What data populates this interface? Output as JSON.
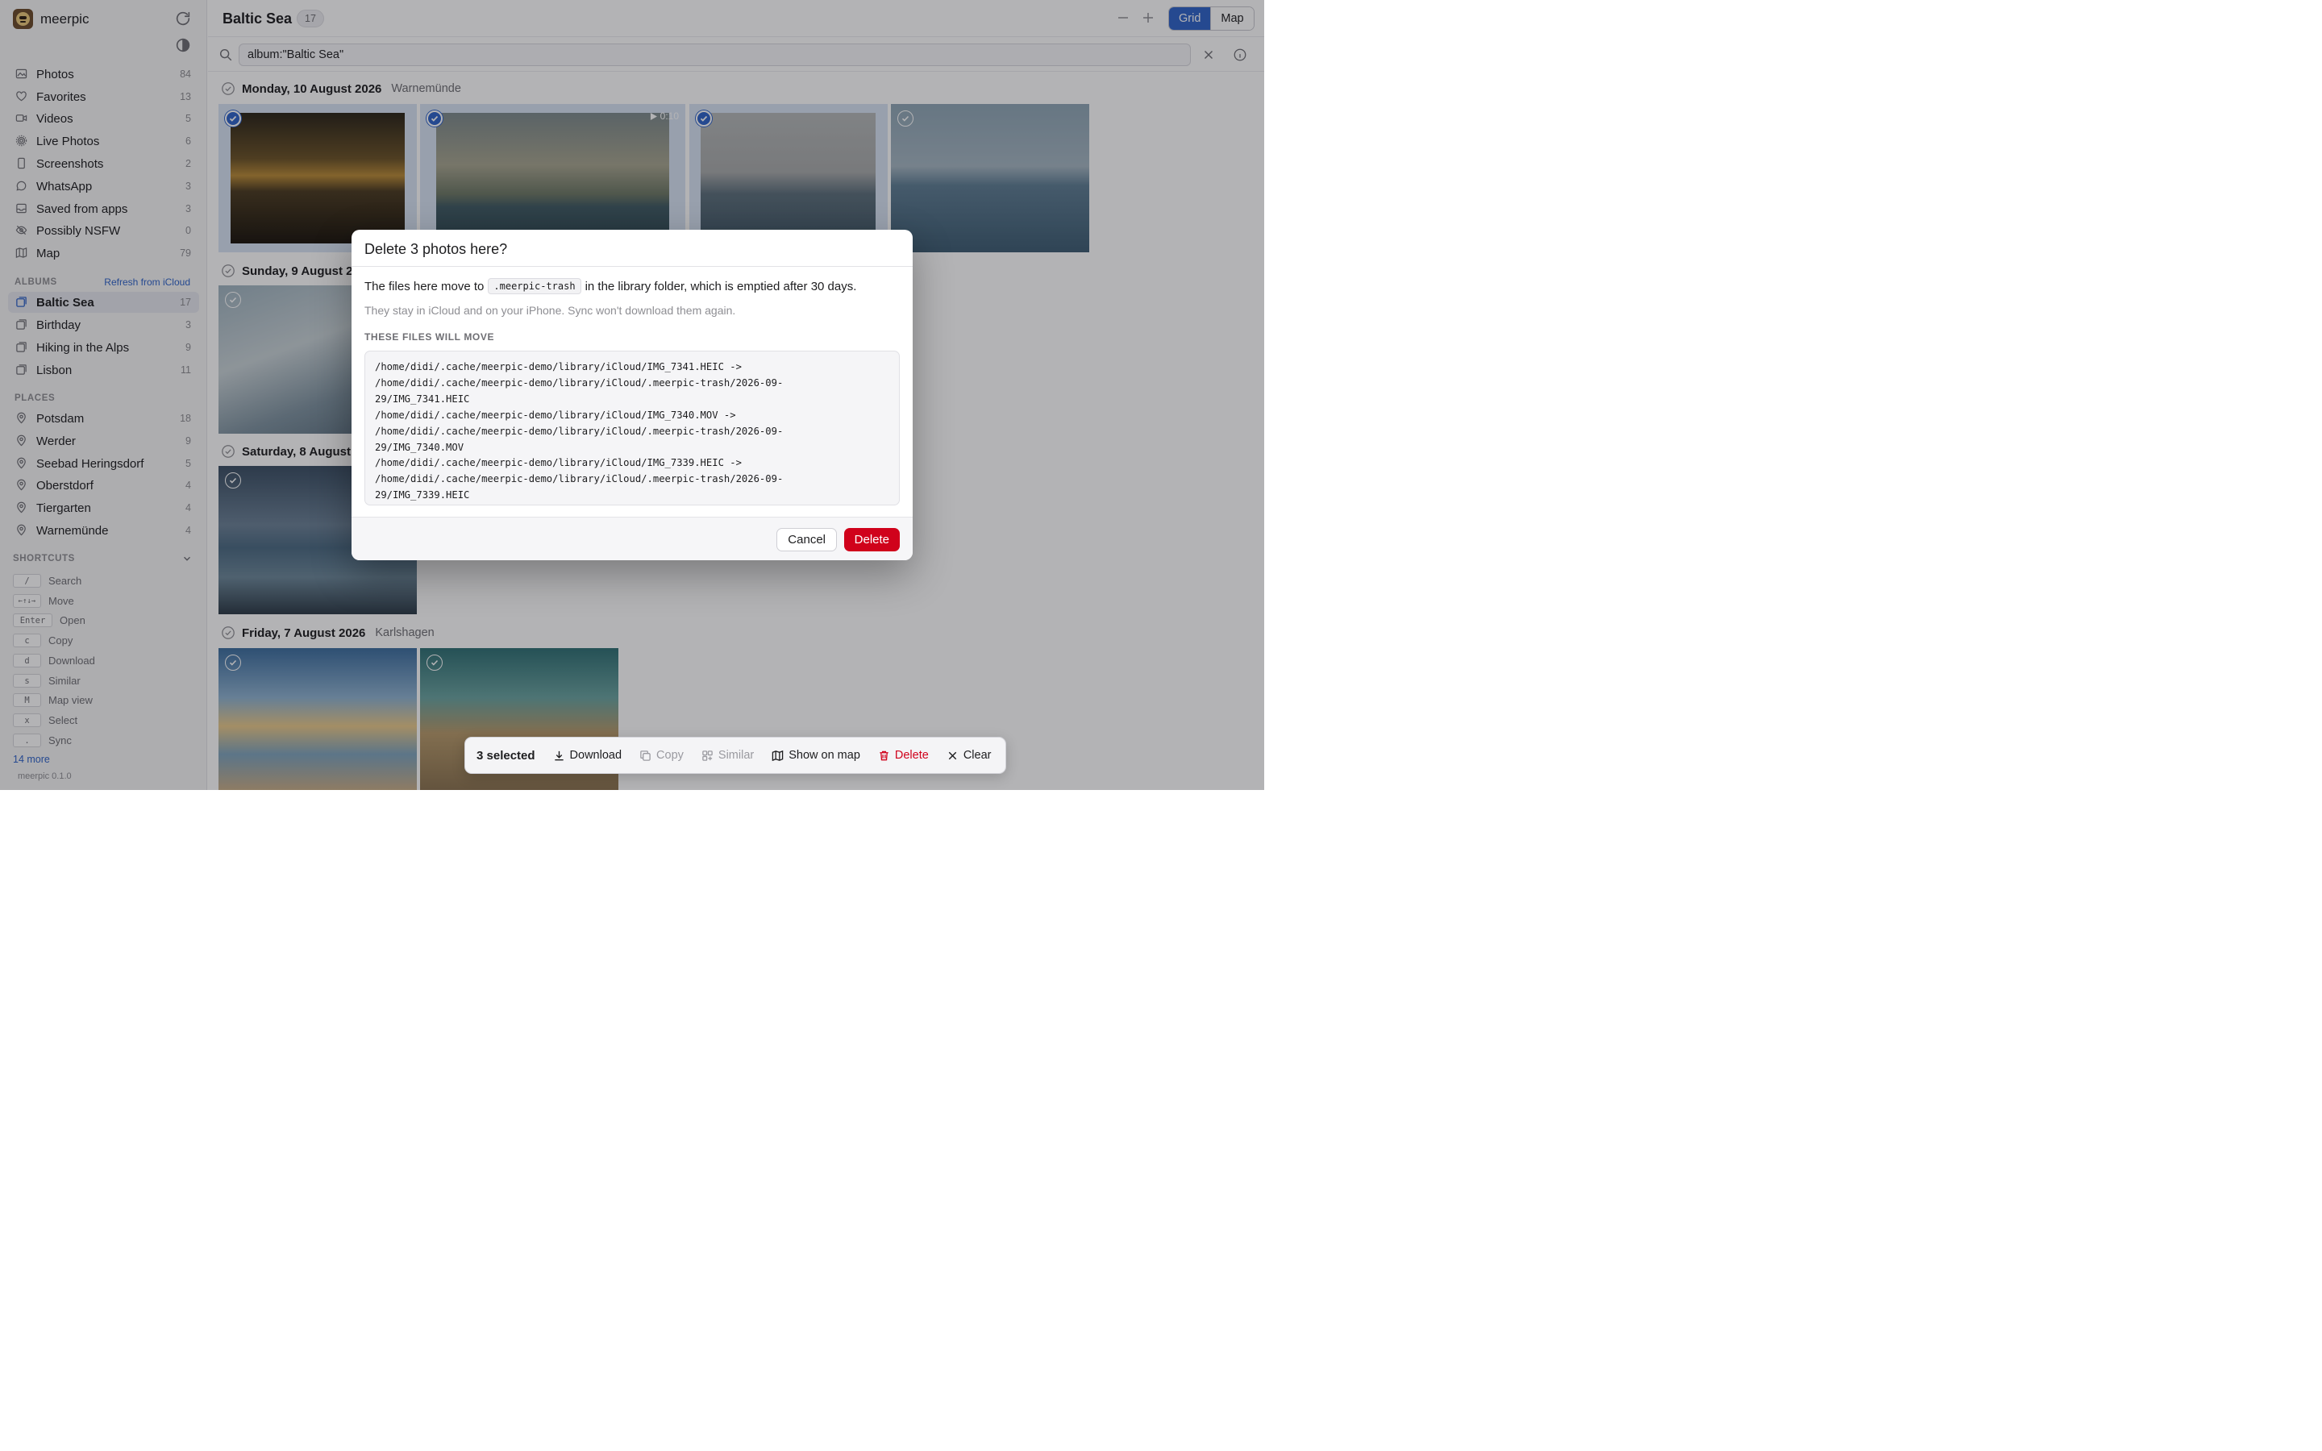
{
  "app": {
    "name": "meerpic",
    "version": "meerpic 0.1.0"
  },
  "nav": [
    {
      "label": "Photos",
      "count": "84",
      "icon": "photo-icon"
    },
    {
      "label": "Favorites",
      "count": "13",
      "icon": "heart-icon"
    },
    {
      "label": "Videos",
      "count": "5",
      "icon": "video-icon"
    },
    {
      "label": "Live Photos",
      "count": "6",
      "icon": "live-photo-icon"
    },
    {
      "label": "Screenshots",
      "count": "2",
      "icon": "phone-icon"
    },
    {
      "label": "WhatsApp",
      "count": "3",
      "icon": "chat-bubble-icon"
    },
    {
      "label": "Saved from apps",
      "count": "3",
      "icon": "inbox-icon"
    },
    {
      "label": "Possibly NSFW",
      "count": "0",
      "icon": "eye-off-icon"
    },
    {
      "label": "Map",
      "count": "79",
      "icon": "map-icon"
    }
  ],
  "albums": {
    "heading": "ALBUMS",
    "refresh": "Refresh from iCloud",
    "items": [
      {
        "label": "Baltic Sea",
        "count": "17",
        "active": true
      },
      {
        "label": "Birthday",
        "count": "3"
      },
      {
        "label": "Hiking in the Alps",
        "count": "9"
      },
      {
        "label": "Lisbon",
        "count": "11"
      }
    ]
  },
  "places": {
    "heading": "PLACES",
    "items": [
      {
        "label": "Potsdam",
        "count": "18"
      },
      {
        "label": "Werder",
        "count": "9"
      },
      {
        "label": "Seebad Heringsdorf",
        "count": "5"
      },
      {
        "label": "Oberstdorf",
        "count": "4"
      },
      {
        "label": "Tiergarten",
        "count": "4"
      },
      {
        "label": "Warnemünde",
        "count": "4"
      }
    ]
  },
  "shortcuts": {
    "heading": "SHORTCUTS",
    "items": [
      {
        "key": "/",
        "label": "Search"
      },
      {
        "key": "←↑↓→",
        "label": "Move"
      },
      {
        "key": "Enter",
        "label": "Open"
      },
      {
        "key": "c",
        "label": "Copy"
      },
      {
        "key": "d",
        "label": "Download"
      },
      {
        "key": "s",
        "label": "Similar"
      },
      {
        "key": "M",
        "label": "Map view"
      },
      {
        "key": "x",
        "label": "Select"
      },
      {
        "key": ".",
        "label": "Sync"
      }
    ],
    "more": "14 more"
  },
  "header": {
    "title": "Baltic Sea",
    "count": "17",
    "view_grid": "Grid",
    "view_map": "Map"
  },
  "search": {
    "value": "album:\"Baltic Sea\""
  },
  "groups": [
    {
      "date": "Monday, 10 August 2026",
      "location": "Warnemünde"
    },
    {
      "date": "Sunday, 9 August 2026",
      "location": ""
    },
    {
      "date": "Saturday, 8 August 2026",
      "location": ""
    },
    {
      "date": "Friday, 7 August 2026",
      "location": "Karlshagen"
    }
  ],
  "video_duration": "0:10",
  "selection_bar": {
    "count": "3 selected",
    "download": "Download",
    "copy": "Copy",
    "similar": "Similar",
    "show_on_map": "Show on map",
    "delete": "Delete",
    "clear": "Clear"
  },
  "dialog": {
    "title": "Delete 3 photos here?",
    "body_before": "The files here move to",
    "body_code": ".meerpic-trash",
    "body_after": "in the library folder, which is emptied after 30 days.",
    "note": "They stay in iCloud and on your iPhone. Sync won't download them again.",
    "files_caption": "THESE FILES WILL MOVE",
    "file_lines": [
      "/home/didi/.cache/meerpic-demo/library/iCloud/IMG_7341.HEIC ->",
      "/home/didi/.cache/meerpic-demo/library/iCloud/.meerpic-trash/2026-09-",
      "29/IMG_7341.HEIC",
      "/home/didi/.cache/meerpic-demo/library/iCloud/IMG_7340.MOV ->",
      "/home/didi/.cache/meerpic-demo/library/iCloud/.meerpic-trash/2026-09-",
      "29/IMG_7340.MOV",
      "/home/didi/.cache/meerpic-demo/library/iCloud/IMG_7339.HEIC ->",
      "/home/didi/.cache/meerpic-demo/library/iCloud/.meerpic-trash/2026-09-",
      "29/IMG_7339.HEIC"
    ],
    "cancel": "Cancel",
    "delete": "Delete"
  },
  "colors": {
    "accent": "#2f63c9",
    "danger": "#d0021b"
  }
}
